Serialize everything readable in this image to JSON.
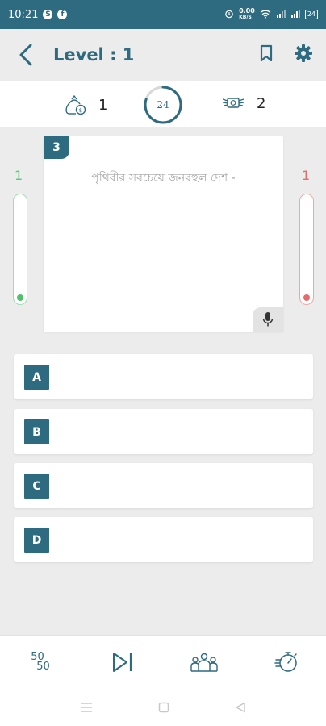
{
  "status_bar": {
    "time": "10:21",
    "net_speed": "0.00",
    "net_unit": "KB/S",
    "battery": "24"
  },
  "header": {
    "title": "Level : 1"
  },
  "stats": {
    "coins": "1",
    "timer": "24",
    "timer_progress": 0.8,
    "prize": "2"
  },
  "scores": {
    "correct": "1",
    "wrong": "1"
  },
  "question": {
    "number": "3",
    "text": "পৃথিবীর সবচেয়ে জনবহুল দেশ -"
  },
  "options": [
    {
      "label": "A",
      "text": ""
    },
    {
      "label": "B",
      "text": ""
    },
    {
      "label": "C",
      "text": ""
    },
    {
      "label": "D",
      "text": ""
    }
  ],
  "lifelines": {
    "fifty_top": "50",
    "fifty_bottom": "50"
  },
  "colors": {
    "primary": "#2e6a80",
    "correct": "#4cc26a",
    "wrong": "#e86a6a"
  }
}
